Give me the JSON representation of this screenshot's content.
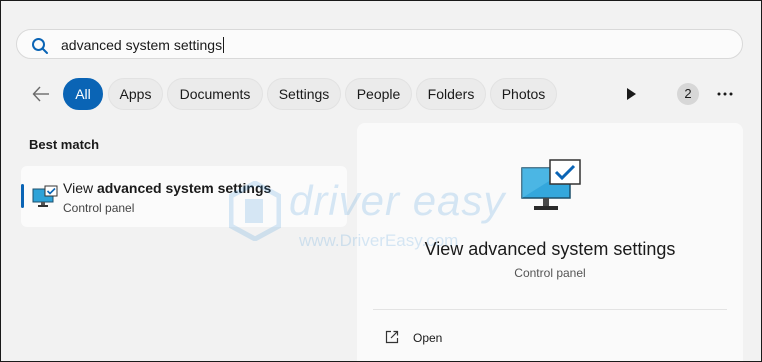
{
  "search": {
    "query": "advanced system settings",
    "icon": "search-icon"
  },
  "filters": {
    "back_icon": "back-arrow-icon",
    "tabs": [
      "All",
      "Apps",
      "Documents",
      "Settings",
      "People",
      "Folders",
      "Photos"
    ],
    "active_tab": "All",
    "play_icon": "play-icon",
    "badge_count": "2",
    "more_icon": "more-icon"
  },
  "results": {
    "section_title": "Best match",
    "best_match": {
      "title_prefix": "View ",
      "title_bold": "advanced system settings",
      "subtitle": "Control panel",
      "icon": "monitor-check-icon"
    }
  },
  "details": {
    "title": "View advanced system settings",
    "subtitle": "Control panel",
    "actions": [
      {
        "label": "Open",
        "icon": "open-external-icon"
      }
    ]
  },
  "watermark": {
    "name": "driver easy",
    "url": "www.DriverEasy.com"
  },
  "colors": {
    "accent": "#0a64b5",
    "background": "#f3f3f3",
    "watermark": "#2e8bd6"
  }
}
